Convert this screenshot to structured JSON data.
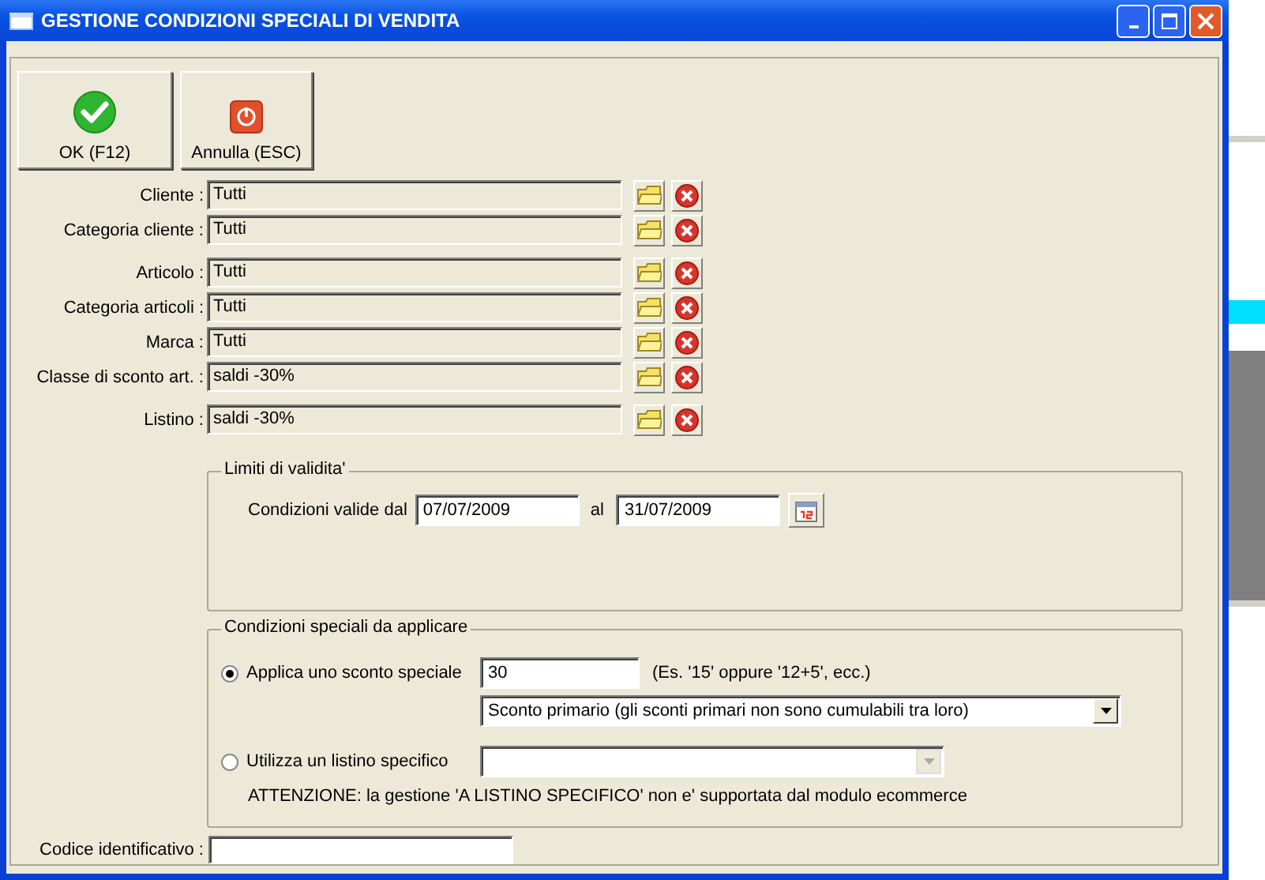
{
  "window": {
    "title": "GESTIONE CONDIZIONI SPECIALI DI VENDITA"
  },
  "toolbar": [
    {
      "kind": "ok",
      "label": "OK (F12)"
    },
    {
      "kind": "cancel",
      "label": "Annulla (ESC)"
    }
  ],
  "filter_groups": [
    {
      "rows": [
        {
          "label": "Cliente :",
          "value": "Tutti"
        },
        {
          "label": "Categoria cliente :",
          "value": "Tutti"
        }
      ]
    },
    {
      "rows": [
        {
          "label": "Articolo :",
          "value": "Tutti"
        },
        {
          "label": "Categoria articoli :",
          "value": "Tutti"
        },
        {
          "label": "Marca :",
          "value": "Tutti"
        },
        {
          "label": "Classe di sconto art. :",
          "value": "saldi -30%"
        }
      ]
    },
    {
      "rows": [
        {
          "label": "Listino :",
          "value": "saldi -30%"
        }
      ]
    }
  ],
  "validity": {
    "title": "Limiti di validita'",
    "from_label": "Condizioni valide dal",
    "from": "07/07/2009",
    "to_label": "al",
    "to": "31/07/2009"
  },
  "special": {
    "title": "Condizioni speciali da applicare",
    "options": [
      {
        "label": "Applica uno sconto speciale",
        "selected": true
      },
      {
        "label": "Utilizza un listino specifico",
        "selected": false
      }
    ],
    "discount": "30",
    "discount_hint": "(Es. '15' oppure '12+5', ecc.)",
    "discount_type": "Sconto primario (gli sconti primari non sono cumulabili tra loro)",
    "warning": "ATTENZIONE: la gestione 'A LISTINO SPECIFICO' non e' supportata dal modulo ecommerce"
  },
  "code": {
    "label": "Codice identificativo :"
  }
}
